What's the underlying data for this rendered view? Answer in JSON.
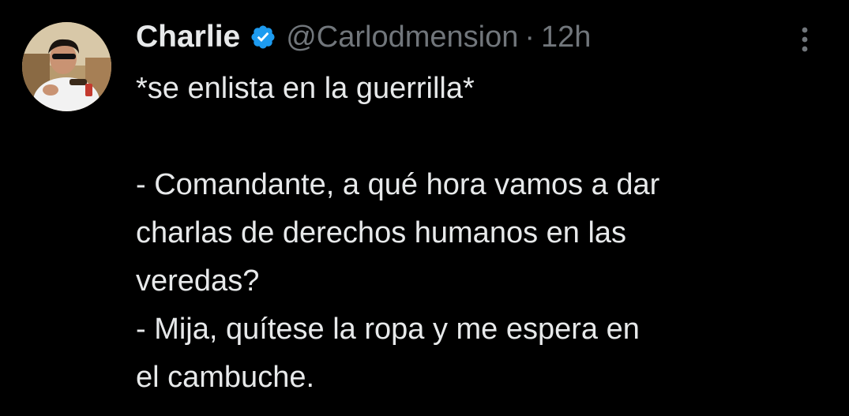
{
  "tweet": {
    "author": {
      "display_name": "Charlie",
      "handle": "@Carlodmension",
      "verified": true,
      "avatar_icon": "profile-photo"
    },
    "separator": "·",
    "timestamp": "12h",
    "more_icon": "more-vertical-icon",
    "lines": {
      "l1": "*se enlista en la guerrilla*",
      "l2": "- Comandante, a qué hora vamos a dar",
      "l3": "charlas de derechos humanos en las",
      "l4": "veredas?",
      "l5": "- Mija, quítese la ropa y me espera en",
      "l6": "el cambuche."
    }
  },
  "colors": {
    "background": "#000000",
    "text_primary": "#e7e9ea",
    "text_secondary": "#71767b",
    "verified_blue": "#1d9bf0"
  }
}
